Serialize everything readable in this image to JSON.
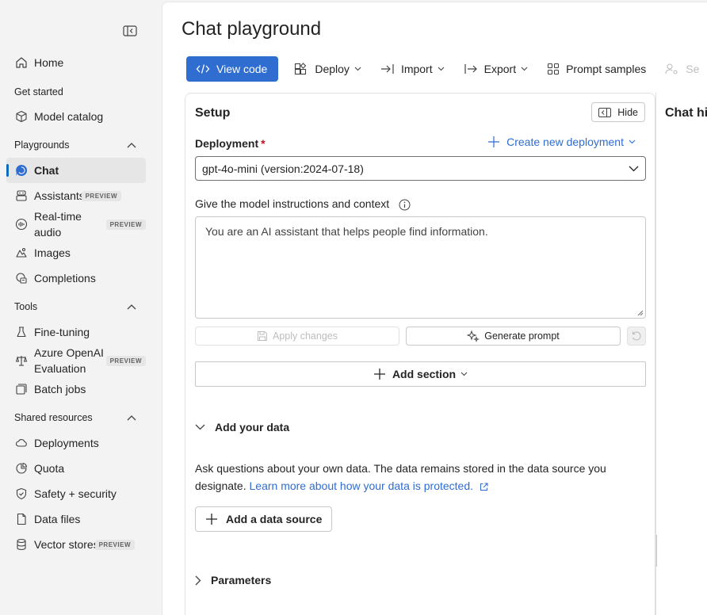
{
  "sidebar": {
    "top_items": [
      {
        "label": "Home",
        "icon": "home-icon"
      }
    ],
    "get_started": {
      "title": "Get started",
      "items": [
        {
          "label": "Model catalog",
          "icon": "cube-icon"
        }
      ]
    },
    "playgrounds": {
      "title": "Playgrounds",
      "items": [
        {
          "label": "Chat",
          "icon": "chat-icon",
          "selected": true
        },
        {
          "label": "Assistants",
          "icon": "assistants-icon",
          "badge": "PREVIEW"
        },
        {
          "label": "Real-time audio",
          "line1": "Real-time",
          "line2": "audio",
          "icon": "audio-icon",
          "badge": "PREVIEW"
        },
        {
          "label": "Images",
          "icon": "image-icon"
        },
        {
          "label": "Completions",
          "icon": "completions-icon"
        }
      ]
    },
    "tools": {
      "title": "Tools",
      "items": [
        {
          "label": "Fine-tuning",
          "icon": "flask-icon"
        },
        {
          "label": "Azure OpenAI Evaluation",
          "line1": "Azure OpenAI",
          "line2": "Evaluation",
          "icon": "scale-icon",
          "badge": "PREVIEW"
        },
        {
          "label": "Batch jobs",
          "icon": "batch-icon"
        }
      ]
    },
    "shared_resources": {
      "title": "Shared resources",
      "items": [
        {
          "label": "Deployments",
          "icon": "cloud-icon"
        },
        {
          "label": "Quota",
          "icon": "quota-icon"
        },
        {
          "label": "Safety + security",
          "icon": "shield-icon"
        },
        {
          "label": "Data files",
          "icon": "document-icon"
        },
        {
          "label": "Vector stores",
          "icon": "vector-store-icon",
          "badge": "PREVIEW"
        }
      ]
    }
  },
  "page": {
    "title": "Chat playground"
  },
  "toolbar": {
    "view_code": "View code",
    "deploy": "Deploy",
    "import": "Import",
    "export": "Export",
    "prompt_samples": "Prompt samples",
    "settings_partial": "Se"
  },
  "setup": {
    "title": "Setup",
    "hide_label": "Hide",
    "deployment_label": "Deployment",
    "required_mark": "*",
    "create_deployment": "Create new deployment",
    "deployment_value": "gpt-4o-mini (version:2024-07-18)",
    "instructions_label": "Give the model instructions and context",
    "instructions_value": "You are an AI assistant that helps people find information.",
    "apply_changes": "Apply changes",
    "generate_prompt": "Generate prompt",
    "add_section": "Add section",
    "add_your_data": {
      "title": "Add your data",
      "description": "Ask questions about your own data. The data remains stored in the data source you designate.",
      "link": "Learn more about how your data is protected.",
      "add_source": "Add a data source"
    },
    "parameters": "Parameters"
  },
  "chat_history": {
    "title_visible": "Chat his"
  },
  "colors": {
    "accent": "#2f6dd0",
    "required": "#c50f1f",
    "selected_bar": "#0f6cbd"
  }
}
